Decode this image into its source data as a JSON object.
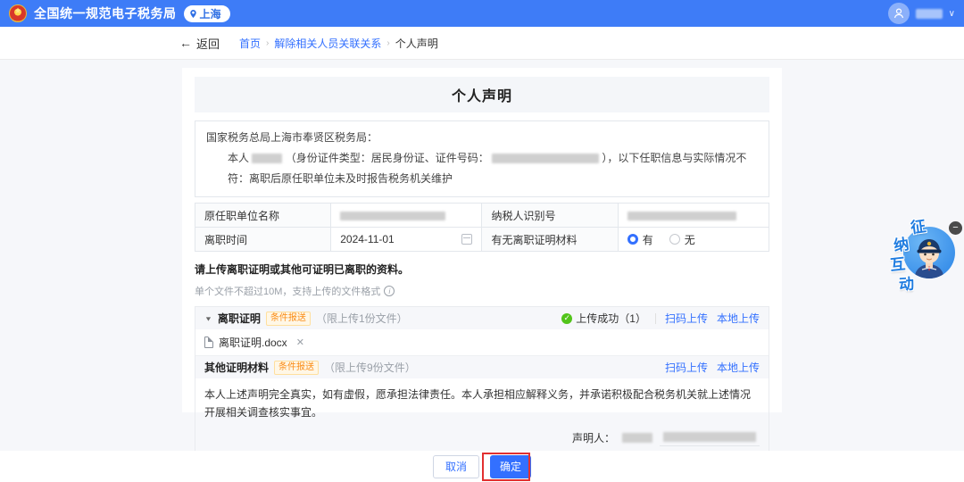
{
  "header": {
    "title": "全国统一规范电子税务局",
    "location": "上海"
  },
  "nav": {
    "back": "返回",
    "breadcrumb": [
      "首页",
      "解除相关人员关联关系",
      "个人声明"
    ],
    "separator": "›"
  },
  "form": {
    "title": "个人声明",
    "salutation": "国家税务总局上海市奉贤区税务局：",
    "body_pre": "本人",
    "body_mid": "（身份证件类型：居民身份证、证件号码：",
    "body_post": "），以下任职信息与实际情况不符：离职后原任职单位未及时报告税务机关维护",
    "fields": {
      "former_unit_label": "原任职单位名称",
      "taxpayer_id_label": "纳税人识别号",
      "leave_date_label": "离职时间",
      "leave_date_value": "2024-11-01",
      "has_proof_label": "有无离职证明材料",
      "radio_yes": "有",
      "radio_no": "无"
    },
    "upload_note": "请上传离职证明或其他可证明已离职的资料。",
    "upload_hint": "单个文件不超过10M，支持上传的文件格式",
    "uploads": [
      {
        "name": "离职证明",
        "badge": "条件报送",
        "limit": "（限上传1份文件）",
        "status": "上传成功（1）",
        "scan": "扫码上传",
        "local": "本地上传",
        "file": "离职证明.docx"
      },
      {
        "name": "其他证明材料",
        "badge": "条件报送",
        "limit": "（限上传9份文件）",
        "scan": "扫码上传",
        "local": "本地上传"
      }
    ],
    "declaration": "本人上述声明完全真实，如有虚假，愿承担法律责任。本人承担相应解释义务，并承诺积极配合税务机关就上述情况开展相关调查核实事宜。",
    "declarant_label": "声明人："
  },
  "footer": {
    "cancel": "取消",
    "confirm": "确定"
  },
  "assistant": {
    "chars": [
      "征",
      "纳",
      "互",
      "动"
    ]
  },
  "colors": {
    "header_blue": "#3e7cf7",
    "link_blue": "#3370ff",
    "badge_orange": "#fa8c16",
    "success_green": "#52c41a",
    "annotation_red": "#e23030"
  }
}
